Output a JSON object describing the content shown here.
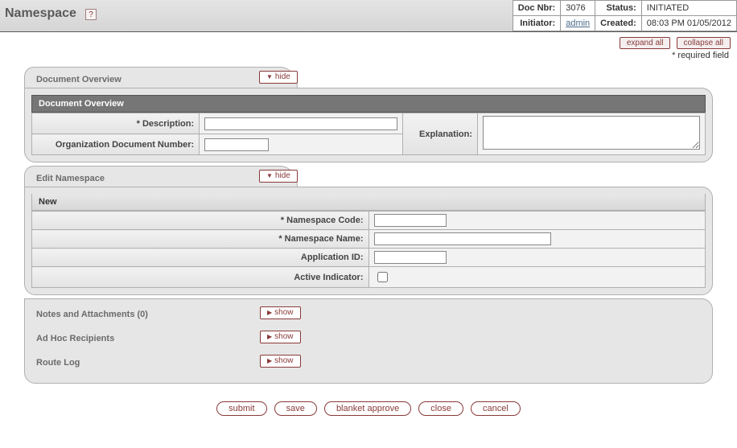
{
  "page": {
    "title": "Namespace"
  },
  "doc_info": {
    "doc_nbr_label": "Doc Nbr:",
    "doc_nbr": "3076",
    "status_label": "Status:",
    "status": "INITIATED",
    "initiator_label": "Initiator:",
    "initiator": "admin",
    "created_label": "Created:",
    "created": "08:03 PM 01/05/2012"
  },
  "toolbar": {
    "expand_all": "expand all",
    "collapse_all": "collapse all",
    "required_note": "* required field"
  },
  "toggle": {
    "hide": "hide",
    "show": "show"
  },
  "tabs": {
    "doc_overview": {
      "title": "Document Overview",
      "section_bar": "Document Overview",
      "description_label": "Description:",
      "org_doc_num_label": "Organization Document Number:",
      "explanation_label": "Explanation:"
    },
    "edit_ns": {
      "title": "Edit Namespace",
      "new_bar": "New",
      "ns_code_label": "Namespace Code:",
      "ns_name_label": "Namespace Name:",
      "app_id_label": "Application ID:",
      "active_label": "Active Indicator:"
    },
    "notes": {
      "title": "Notes and Attachments (0)"
    },
    "adhoc": {
      "title": "Ad Hoc Recipients"
    },
    "routelog": {
      "title": "Route Log"
    }
  },
  "actions": {
    "submit": "submit",
    "save": "save",
    "blanket": "blanket approve",
    "close": "close",
    "cancel": "cancel"
  }
}
